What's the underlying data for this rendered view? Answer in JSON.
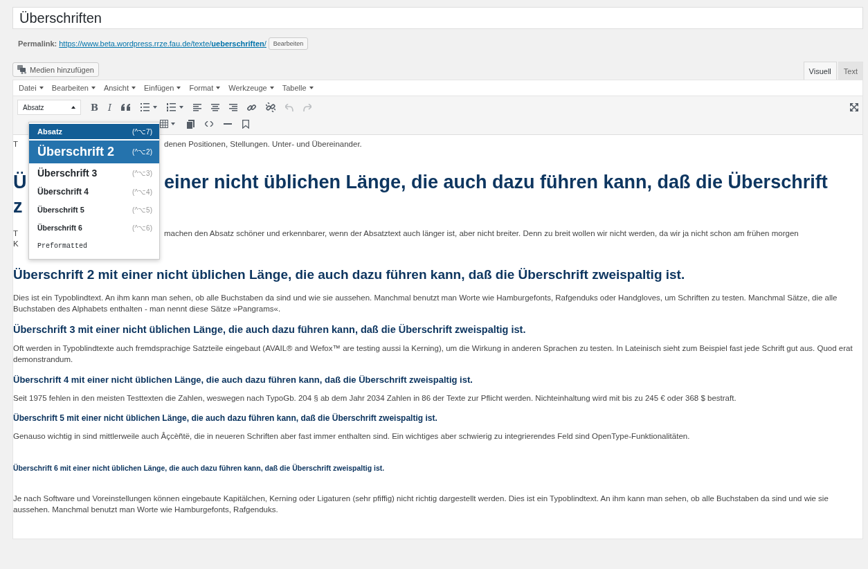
{
  "title_field": {
    "value": "Überschriften"
  },
  "permalink": {
    "label": "Permalink:",
    "url_base": "https://www.beta.wordpress.rrze.fau.de/texte/",
    "slug": "ueberschriften",
    "suffix": "/",
    "edit_button": "Bearbeiten"
  },
  "media_button": "Medien hinzufügen",
  "editor_tabs": [
    {
      "label": "Visuell",
      "selected": true
    },
    {
      "label": "Text",
      "selected": false
    }
  ],
  "menu": [
    "Datei",
    "Bearbeiten",
    "Ansicht",
    "Einfügen",
    "Format",
    "Werkzeuge",
    "Tabelle"
  ],
  "toolbar": {
    "format_select": "Absatz",
    "bold": "B",
    "italic": "I",
    "undo": {
      "disabled": true
    },
    "redo": {
      "disabled": true
    }
  },
  "format_dropdown": [
    {
      "kind": "p",
      "label": "Absatz",
      "shortcut": "(^⌥7)",
      "selected": true,
      "hovered": false
    },
    {
      "kind": "h2",
      "label": "Überschrift 2",
      "shortcut": "(^⌥2)",
      "selected": false,
      "hovered": true
    },
    {
      "kind": "h3",
      "label": "Überschrift 3",
      "shortcut": "(^⌥3)",
      "selected": false,
      "hovered": false
    },
    {
      "kind": "h4",
      "label": "Überschrift 4",
      "shortcut": "(^⌥4)",
      "selected": false,
      "hovered": false
    },
    {
      "kind": "h5",
      "label": "Überschrift 5",
      "shortcut": "(^⌥5)",
      "selected": false,
      "hovered": false
    },
    {
      "kind": "h6",
      "label": "Überschrift 6",
      "shortcut": "(^⌥6)",
      "selected": false,
      "hovered": false
    },
    {
      "kind": "pre",
      "label": "Preformatted",
      "selected": false,
      "hovered": false
    }
  ],
  "covered_blocks": [
    {
      "kind": "p",
      "lines": [
        {
          "left": "T",
          "right": "denen Positionen, Stellungen. Unter- und Übereinander."
        }
      ]
    },
    {
      "kind": "h1",
      "lines": [
        {
          "left": "Ü",
          "right": "einer nicht üblichen Länge, die auch dazu führen kann, daß die Überschrift"
        },
        {
          "left": "z"
        }
      ]
    },
    {
      "kind": "p",
      "lines": [
        {
          "left": "T",
          "right": "machen den Absatz schöner und erkennbarer, wenn der Absatztext auch länger ist, aber nicht breiter. Denn zu breit wollen wir nicht werden, da wir ja nicht schon am frühen morgen"
        },
        {
          "left": "K"
        }
      ]
    }
  ],
  "blocks": [
    {
      "kind": "h2",
      "text": "Überschrift 2 mit einer nicht üblichen Länge, die auch dazu führen kann, daß die Überschrift zweispaltig ist."
    },
    {
      "kind": "p",
      "text": "Dies ist ein Typoblindtext. An ihm kann man sehen, ob alle Buchstaben da sind und wie sie aussehen. Manchmal benutzt man Worte wie Hamburgefonts, Rafgenduks oder Handgloves, um Schriften zu testen. Manchmal Sätze, die alle Buchstaben des Alphabets enthalten - man nennt diese Sätze »Pangrams«."
    },
    {
      "kind": "h3",
      "text": "Überschrift 3 mit einer nicht üblichen Länge, die auch dazu führen kann, daß die Überschrift zweispaltig ist."
    },
    {
      "kind": "p",
      "text": "Oft werden in Typoblindtexte auch fremdsprachige Satzteile eingebaut (AVAIL® and Wefox™ are testing aussi la Kerning), um die Wirkung in anderen Sprachen zu testen. In Lateinisch sieht zum Beispiel fast jede Schrift gut aus. Quod erat demonstrandum."
    },
    {
      "kind": "h4",
      "text": "Überschrift 4 mit einer nicht üblichen Länge, die auch dazu führen kann, daß die Überschrift zweispaltig ist."
    },
    {
      "kind": "p",
      "text": "Seit 1975 fehlen in den meisten Testtexten die Zahlen, weswegen nach TypoGb. 204 § ab dem Jahr 2034 Zahlen in 86 der Texte zur Pflicht werden. Nichteinhaltung wird mit bis zu 245 € oder 368 $ bestraft."
    },
    {
      "kind": "h5",
      "text": "Überschrift 5 mit einer nicht üblichen Länge, die auch dazu führen kann, daß die Überschrift zweispaltig ist."
    },
    {
      "kind": "p",
      "text": "Genauso wichtig in sind mittlerweile auch Âçcèñtë, die in neueren Schriften aber fast immer enthalten sind. Ein wichtiges aber schwierig zu integrierendes Feld sind OpenType-Funktionalitäten."
    },
    {
      "kind": "h6",
      "text": "Überschrift 6 mit einer nicht üblichen Länge, die auch dazu führen kann, daß die Überschrift zweispaltig ist."
    },
    {
      "kind": "p",
      "text": "Je nach Software und Voreinstellungen können eingebaute Kapitälchen, Kerning oder Ligaturen (sehr pfiffig) nicht richtig dargestellt werden. Dies ist ein Typoblindtext. An ihm kann man sehen, ob alle Buchstaben da sind und wie sie aussehen. Manchmal benutzt man Worte wie Hamburgefonts, Rafgenduks."
    }
  ]
}
